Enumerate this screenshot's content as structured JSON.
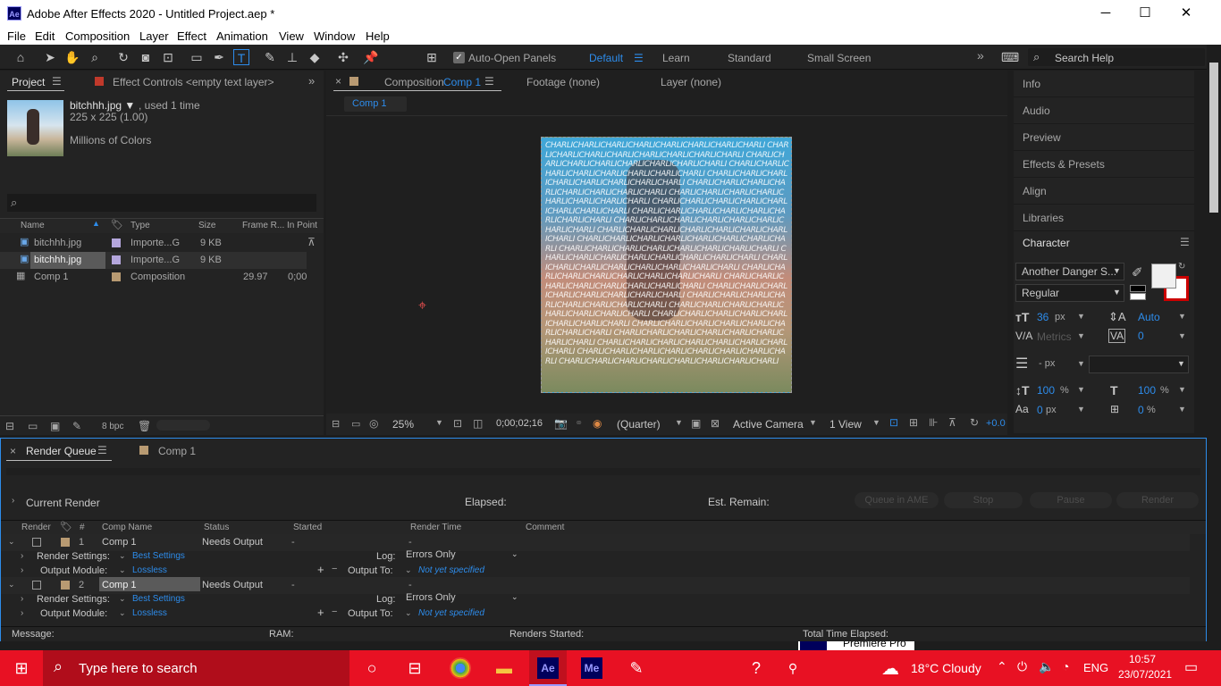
{
  "window": {
    "title": "Adobe After Effects 2020 - Untitled Project.aep *",
    "app_badge": "Ae",
    "minimize": "─",
    "maximize": "☐",
    "close": "✕"
  },
  "menu": [
    "File",
    "Edit",
    "Composition",
    "Layer",
    "Effect",
    "Animation",
    "View",
    "Window",
    "Help"
  ],
  "toolbar": {
    "auto_open": "Auto-Open Panels",
    "workspaces": [
      "Default",
      "Learn",
      "Standard",
      "Small Screen"
    ],
    "search_help": "Search Help",
    "more": "»"
  },
  "project": {
    "tab": "Project",
    "effect_controls": "Effect Controls <empty text layer>",
    "thumb_name": "bitchhh.jpg ▼",
    "thumb_used": ", used 1 time",
    "thumb_dims": "225 x 225 (1.00)",
    "thumb_colors": "Millions of Colors",
    "search_placeholder": "",
    "columns": [
      "Name",
      "Type",
      "Size",
      "Frame R...",
      "In Point"
    ],
    "rows": [
      {
        "name": "bitchhh.jpg",
        "type": "Importe...G",
        "size": "9 KB",
        "fr": "",
        "in": ""
      },
      {
        "name": "bitchhh.jpg",
        "type": "Importe...G",
        "size": "9 KB",
        "fr": "",
        "in": ""
      },
      {
        "name": "Comp 1",
        "type": "Composition",
        "size": "",
        "fr": "29.97",
        "in": "0;00"
      }
    ],
    "bpc": "8 bpc"
  },
  "comp": {
    "tab_prefix": "Composition",
    "tab_name": "Comp 1",
    "footage": "Footage (none)",
    "layer": "Layer (none)",
    "subtab": "Comp 1",
    "overlay_text": "CHARLICHARLICHARLICHARLICHARLICHARLICHARLICHARLI",
    "zoom": "25%",
    "timecode": "0;00;02;16",
    "resolution": "(Quarter)",
    "camera": "Active Camera",
    "views": "1 View",
    "exposure": "+0.0"
  },
  "right_panels": [
    "Info",
    "Audio",
    "Preview",
    "Effects & Presets",
    "Align",
    "Libraries"
  ],
  "character": {
    "title": "Character",
    "font": "Another Danger S...",
    "style": "Regular",
    "size": "36",
    "size_unit": "px",
    "leading": "Auto",
    "kerning": "Metrics",
    "tracking": "0",
    "stroke": "- px",
    "vscale": "100",
    "vscale_unit": "%",
    "hscale": "100",
    "hscale_unit": "%",
    "baseline": "0",
    "baseline_unit": "px",
    "tsume": "0",
    "tsume_unit": "%"
  },
  "render_queue": {
    "tab": "Render Queue",
    "comp_tab": "Comp 1",
    "current_render": "Current Render",
    "elapsed": "Elapsed:",
    "est_remain": "Est. Remain:",
    "buttons": [
      "Queue in AME",
      "Stop",
      "Pause",
      "Render"
    ],
    "columns": [
      "Render",
      "#",
      "Comp Name",
      "Status",
      "Started",
      "Render Time",
      "Comment"
    ],
    "items": [
      {
        "num": "1",
        "name": "Comp 1",
        "status": "Needs Output",
        "started": "-",
        "time": "-"
      },
      {
        "num": "2",
        "name": "Comp 1",
        "status": "Needs Output",
        "started": "-",
        "time": "-"
      }
    ],
    "render_settings_label": "Render Settings:",
    "render_settings_value": "Best Settings",
    "output_module_label": "Output Module:",
    "output_module_value": "Lossless",
    "log_label": "Log:",
    "log_value": "Errors Only",
    "output_to_label": "Output To:",
    "output_to_value": "Not yet specified",
    "message": "Message:",
    "ram": "RAM:",
    "renders_started": "Renders Started:",
    "total_elapsed": "Total Time Elapsed:",
    "behind": "Premiere Pro"
  },
  "taskbar": {
    "search": "Type here to search",
    "weather": "18°C  Cloudy",
    "lang": "ENG",
    "time": "10:57",
    "date": "23/07/2021"
  }
}
